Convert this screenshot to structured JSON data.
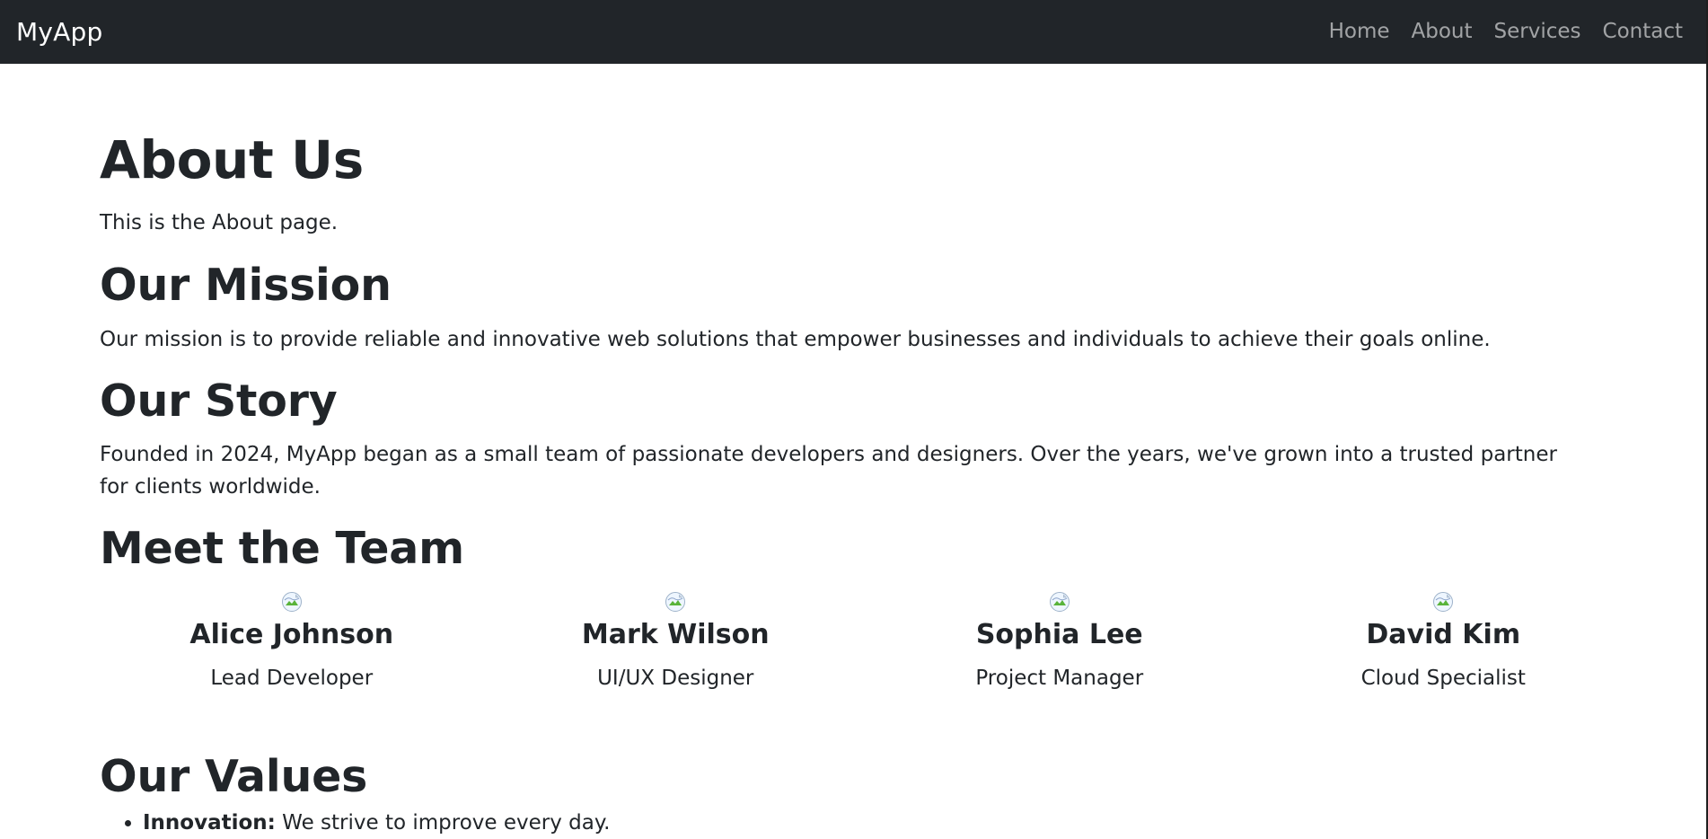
{
  "app": {
    "brand": "MyApp",
    "colors": {
      "navbar": "#212529",
      "text": "#212529",
      "nav_link": "rgba(255,255,255,0.58)"
    }
  },
  "navbar": {
    "links": [
      {
        "label": "Home"
      },
      {
        "label": "About"
      },
      {
        "label": "Services"
      },
      {
        "label": "Contact"
      }
    ]
  },
  "main": {
    "title": "About Us",
    "intro": "This is the About page.",
    "mission": {
      "heading": "Our Mission",
      "text": "Our mission is to provide reliable and innovative web solutions that empower businesses and individuals to achieve their goals online."
    },
    "story": {
      "heading": "Our Story",
      "text": "Founded in 2024, MyApp began as a small team of passionate developers and designers. Over the years, we've grown into a trusted partner for clients worldwide."
    },
    "team": {
      "heading": "Meet the Team",
      "members": [
        {
          "name": "Alice Johnson",
          "role": "Lead Developer",
          "icon": "broken-image-icon"
        },
        {
          "name": "Mark Wilson",
          "role": "UI/UX Designer",
          "icon": "broken-image-icon"
        },
        {
          "name": "Sophia Lee",
          "role": "Project Manager",
          "icon": "broken-image-icon"
        },
        {
          "name": "David Kim",
          "role": "Cloud Specialist",
          "icon": "broken-image-icon"
        }
      ]
    },
    "values": {
      "heading": "Our Values",
      "items": [
        {
          "label": "Innovation:",
          "text": " We strive to improve every day."
        }
      ]
    }
  }
}
